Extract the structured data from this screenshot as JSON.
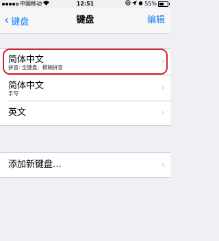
{
  "status_bar": {
    "carrier": "中国移动",
    "time": "12:51",
    "battery": "55%"
  },
  "nav": {
    "back_label": "键盘",
    "title": "键盘",
    "edit_label": "编辑"
  },
  "keyboards": [
    {
      "title": "简体中文",
      "subtitle": "拼音: 全键盘、模糊拼音",
      "highlighted": true
    },
    {
      "title": "简体中文",
      "subtitle": "手写"
    },
    {
      "title": "英文"
    }
  ],
  "add_keyboard": {
    "label": "添加新键盘…"
  },
  "colors": {
    "accent": "#147efb",
    "highlight": "#d9202a"
  }
}
